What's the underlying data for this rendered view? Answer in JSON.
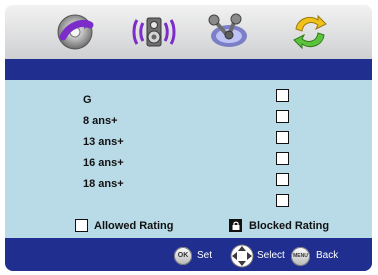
{
  "menu": {
    "tabs": [
      {
        "name": "disc-icon"
      },
      {
        "name": "speaker-icon"
      },
      {
        "name": "settings-icon"
      },
      {
        "name": "language-icon"
      }
    ]
  },
  "ratings": {
    "items": [
      {
        "label": "G",
        "checked": false
      },
      {
        "label": "8 ans+",
        "checked": false
      },
      {
        "label": "13 ans+",
        "checked": false
      },
      {
        "label": "16 ans+",
        "checked": false
      },
      {
        "label": "18 ans+",
        "checked": false
      },
      {
        "label": "",
        "checked": false
      }
    ]
  },
  "legend": {
    "allowed_label": "Allowed Rating",
    "blocked_label": "Blocked Rating"
  },
  "footer": {
    "ok_text": "OK",
    "set_label": "Set",
    "select_label": "Select",
    "menu_text": "MENU",
    "back_label": "Back"
  },
  "colors": {
    "accent_blue": "#1f2e8f",
    "content_background": "#b9dbe8",
    "top_gradient_top": "#f2f2f2",
    "top_gradient_bottom": "#cfd0d2"
  }
}
